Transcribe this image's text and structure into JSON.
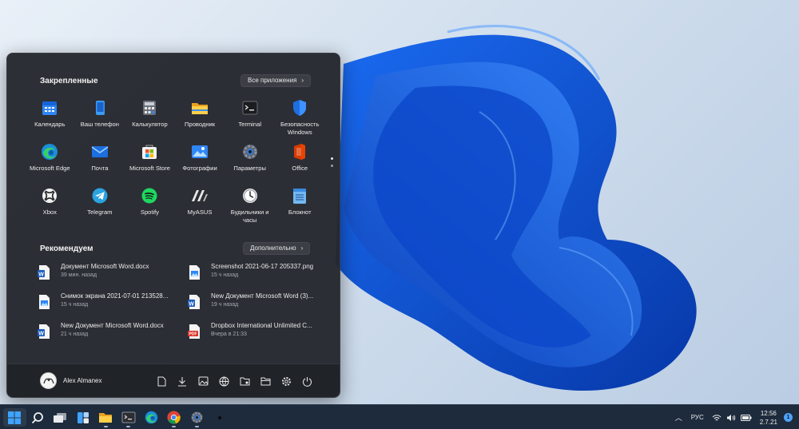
{
  "start_menu": {
    "pinned_title": "Закрепленные",
    "all_apps_label": "Все приложения",
    "pinned_apps": [
      {
        "label": "Календарь",
        "icon": "calendar-icon"
      },
      {
        "label": "Ваш телефон",
        "icon": "phone-icon"
      },
      {
        "label": "Калькулятор",
        "icon": "calculator-icon"
      },
      {
        "label": "Проводник",
        "icon": "folder-icon"
      },
      {
        "label": "Terminal",
        "icon": "terminal-icon"
      },
      {
        "label": "Безопасность Windows",
        "icon": "shield-icon"
      },
      {
        "label": "Microsoft Edge",
        "icon": "edge-icon"
      },
      {
        "label": "Почта",
        "icon": "mail-icon"
      },
      {
        "label": "Microsoft Store",
        "icon": "store-icon"
      },
      {
        "label": "Фотографии",
        "icon": "photos-icon"
      },
      {
        "label": "Параметры",
        "icon": "settings-icon"
      },
      {
        "label": "Office",
        "icon": "office-icon"
      },
      {
        "label": "Xbox",
        "icon": "xbox-icon"
      },
      {
        "label": "Telegram",
        "icon": "telegram-icon"
      },
      {
        "label": "Spotify",
        "icon": "spotify-icon"
      },
      {
        "label": "MyASUS",
        "icon": "myasus-icon"
      },
      {
        "label": "Будильники и часы",
        "icon": "clock-icon"
      },
      {
        "label": "Блокнот",
        "icon": "notepad-icon"
      }
    ],
    "recommended_title": "Рекомендуем",
    "more_label": "Дополнительно",
    "recommended": [
      {
        "name": "Документ Microsoft Word.docx",
        "time": "39 мин. назад",
        "icon": "word-doc-icon"
      },
      {
        "name": "Screenshot 2021-06-17 205337.png",
        "time": "15 ч назад",
        "icon": "image-file-icon"
      },
      {
        "name": "Снимок экрана 2021-07-01 213528...",
        "time": "15 ч назад",
        "icon": "image-file-icon"
      },
      {
        "name": "New Документ Microsoft Word (3)...",
        "time": "19 ч назад",
        "icon": "word-doc-icon"
      },
      {
        "name": "New Документ Microsoft Word.docx",
        "time": "21 ч назад",
        "icon": "word-doc-icon"
      },
      {
        "name": "Dropbox International Unlimited C...",
        "time": "Вчера в 21:33",
        "icon": "pdf-file-icon"
      }
    ],
    "user_name": "Alex Almanex",
    "footer_icons": [
      "documents-icon",
      "downloads-icon",
      "pictures-icon",
      "network-icon",
      "personal-folder-icon",
      "file-explorer-icon",
      "settings-icon",
      "power-icon"
    ]
  },
  "taskbar": {
    "icons": [
      "windows-start-icon",
      "search-icon",
      "task-view-icon",
      "widgets-icon",
      "file-explorer-icon",
      "terminal-icon",
      "edge-icon",
      "chrome-icon",
      "settings-icon",
      "app-icon"
    ],
    "tray": {
      "language": "РУС",
      "time": "12:56",
      "date": "2.7.21",
      "notification_count": "1"
    }
  },
  "colors": {
    "accent": "#0a5bd6",
    "menu_bg": "#24272d",
    "taskbar_bg": "#1d2b3d"
  }
}
